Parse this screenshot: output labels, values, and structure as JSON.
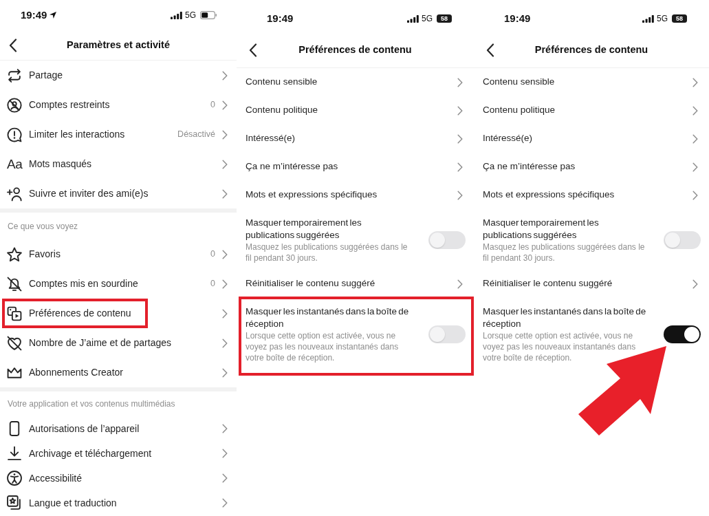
{
  "panels": [
    {
      "kind": "menu",
      "status_bar": {
        "time": "19:49",
        "location": true,
        "network": "5G"
      },
      "header": {
        "title": "Paramètres et activité"
      },
      "arrow_annotation": false,
      "sections": [
        {
          "items": [
            {
              "label": "Partage",
              "highlighted": false
            },
            {
              "label": "Comptes restreints",
              "value": "0",
              "highlighted": false
            },
            {
              "label": "Limiter les interactions",
              "value": "Désactivé",
              "highlighted": false
            },
            {
              "label": "Mots masqués",
              "icon_text": "Aa",
              "highlighted": false
            },
            {
              "label": "Suivre et inviter des ami(e)s",
              "highlighted": false
            }
          ]
        },
        {
          "heading": "Ce que vous voyez",
          "items": [
            {
              "label": "Favoris",
              "value": "0",
              "highlighted": false
            },
            {
              "label": "Comptes mis en sourdine",
              "value": "0",
              "highlighted": false
            },
            {
              "label": "Préférences de contenu",
              "highlighted": true
            },
            {
              "label": "Nombre de J’aime et de partages",
              "highlighted": false
            },
            {
              "label": "Abonnements Creator",
              "highlighted": false
            }
          ]
        },
        {
          "heading": "Votre application et vos contenus multimédias",
          "items": [
            {
              "label": "Autorisations de l’appareil",
              "highlighted": false
            },
            {
              "label": "Archivage et téléchargement",
              "highlighted": false
            },
            {
              "label": "Accessibilité",
              "highlighted": false
            },
            {
              "label": "Langue et traduction",
              "highlighted": false
            }
          ]
        }
      ]
    },
    {
      "kind": "preferences",
      "status_bar": {
        "time": "19:49",
        "location": false,
        "network": "5G",
        "battery": "58"
      },
      "header": {
        "title": "Préférences de contenu"
      },
      "arrow_annotation": false,
      "items": [
        {
          "kind": "link",
          "label": "Contenu sensible",
          "highlighted": false
        },
        {
          "kind": "link",
          "label": "Contenu politique",
          "highlighted": false
        },
        {
          "kind": "link",
          "label": "Intéressé(e)",
          "highlighted": false
        },
        {
          "kind": "link",
          "label": "Ça ne m’intéresse pas",
          "highlighted": false
        },
        {
          "kind": "link",
          "label": "Mots et expressions spécifiques",
          "highlighted": false
        },
        {
          "kind": "toggle",
          "label": "Masquer temporairement les publications suggérées",
          "description": "Masquez les publications suggérées dans le fil pendant 30 jours.",
          "on": false,
          "highlighted": false
        },
        {
          "kind": "link",
          "label": "Réinitialiser le contenu suggéré",
          "highlighted": false
        },
        {
          "kind": "toggle",
          "label": "Masquer les instantanés dans la boîte de réception",
          "description": "Lorsque cette option est activée, vous ne voyez pas les nouveaux instantanés dans votre boîte de réception.",
          "on": false,
          "highlighted": true
        }
      ]
    },
    {
      "kind": "preferences",
      "status_bar": {
        "time": "19:49",
        "location": false,
        "network": "5G",
        "battery": "58"
      },
      "header": {
        "title": "Préférences de contenu"
      },
      "arrow_annotation": true,
      "items": [
        {
          "kind": "link",
          "label": "Contenu sensible",
          "highlighted": false
        },
        {
          "kind": "link",
          "label": "Contenu politique",
          "highlighted": false
        },
        {
          "kind": "link",
          "label": "Intéressé(e)",
          "highlighted": false
        },
        {
          "kind": "link",
          "label": "Ça ne m’intéresse pas",
          "highlighted": false
        },
        {
          "kind": "link",
          "label": "Mots et expressions spécifiques",
          "highlighted": false
        },
        {
          "kind": "toggle",
          "label": "Masquer temporairement les publications suggérées",
          "description": "Masquez les publications suggérées dans le fil pendant 30 jours.",
          "on": false,
          "highlighted": false
        },
        {
          "kind": "link",
          "label": "Réinitialiser le contenu suggéré",
          "highlighted": false
        },
        {
          "kind": "toggle",
          "label": "Masquer les instantanés dans la boîte de réception",
          "description": "Lorsque cette option est activée, vous ne voyez pas les nouveaux instantanés dans votre boîte de réception.",
          "on": true,
          "highlighted": false
        }
      ]
    }
  ]
}
